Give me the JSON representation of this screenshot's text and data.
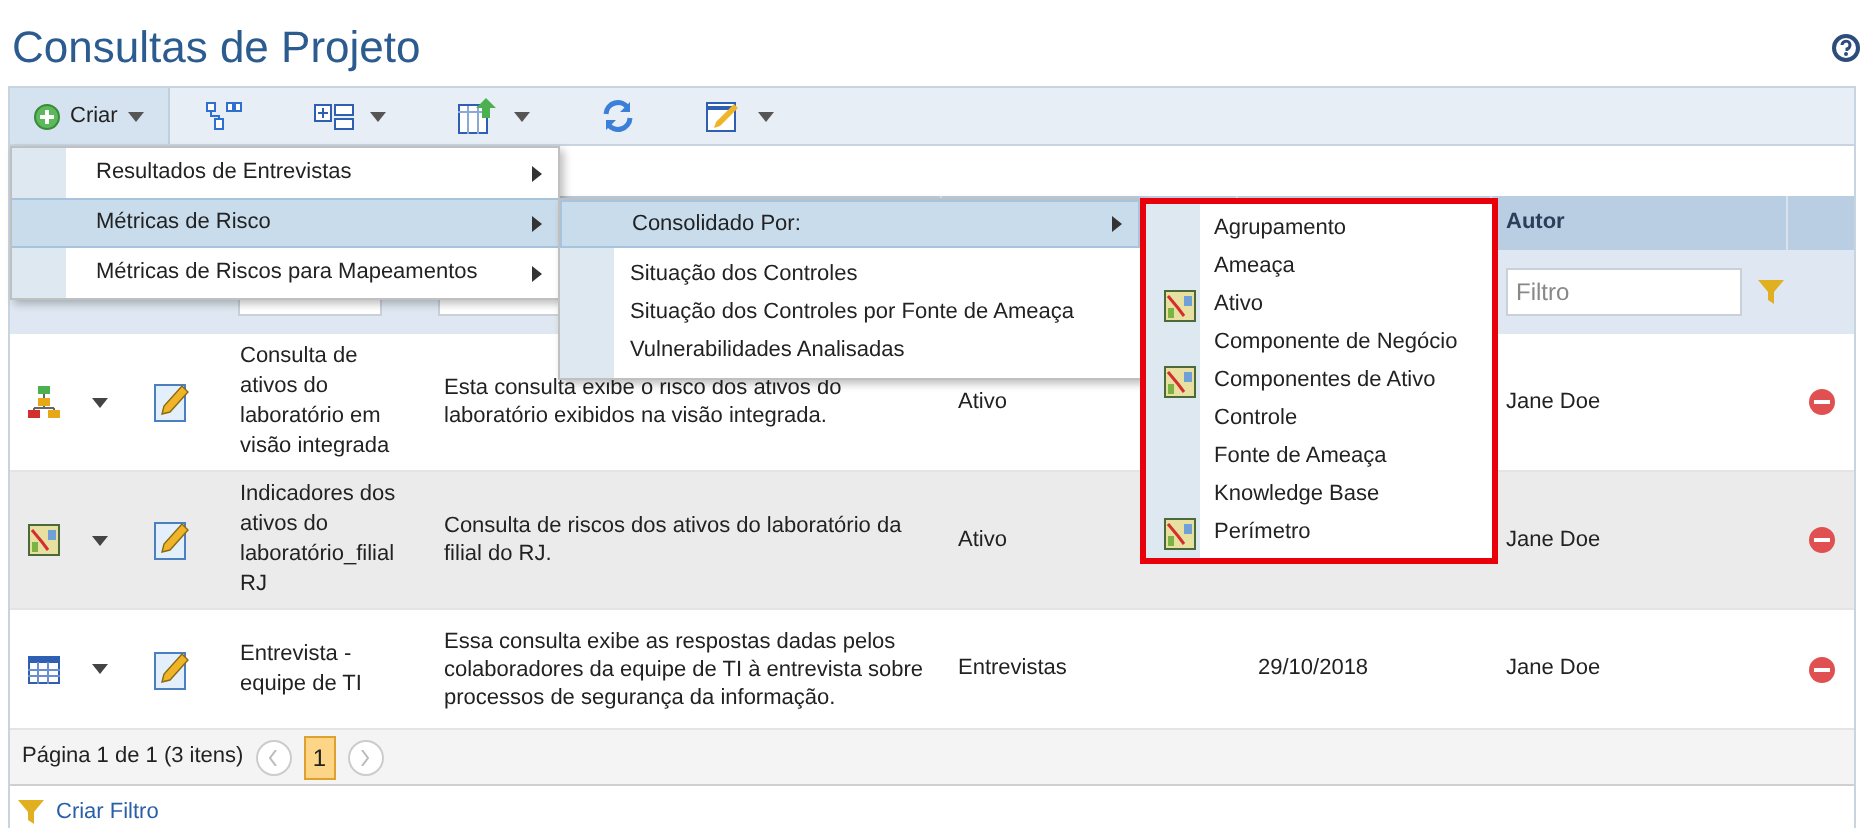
{
  "page": {
    "title": "Consultas de Projeto"
  },
  "toolbar": {
    "create_button": "Criar"
  },
  "create_menu": [
    {
      "label": "Resultados de Entrevistas",
      "selected": false
    },
    {
      "label": "Métricas de Risco",
      "selected": true
    },
    {
      "label": "Métricas de Riscos para Mapeamentos",
      "selected": false
    }
  ],
  "risk_submenu": {
    "header": {
      "label": "Consolidado Por:",
      "selected": true
    },
    "items": [
      "Situação dos Controles",
      "Situação dos Controles por Fonte de Ameaça",
      "Vulnerabilidades Analisadas"
    ]
  },
  "consolidated_submenu": [
    {
      "label": "Agrupamento",
      "has_icon": false
    },
    {
      "label": "Ameaça",
      "has_icon": false
    },
    {
      "label": "Ativo",
      "has_icon": true
    },
    {
      "label": "Componente de Negócio",
      "has_icon": false
    },
    {
      "label": "Componentes de Ativo",
      "has_icon": true
    },
    {
      "label": "Controle",
      "has_icon": false
    },
    {
      "label": "Fonte de Ameaça",
      "has_icon": false
    },
    {
      "label": "Knowledge Base",
      "has_icon": false
    },
    {
      "label": "Perímetro",
      "has_icon": true
    }
  ],
  "table": {
    "author_header": "Autor",
    "filters": [
      {
        "placeholder": "Filtro"
      }
    ],
    "rows": [
      {
        "kind": "hierarchy",
        "selected": false,
        "name": "Consulta de ativos do laboratório em visão integrada",
        "description": "Esta consulta exibe o risco dos ativos do laboratório exibidos na visão integrada.",
        "type": "Ativo",
        "author": "Jane Doe"
      },
      {
        "kind": "chart",
        "selected": true,
        "name": "Indicadores dos ativos do laboratório_filial RJ",
        "description": "Consulta de riscos dos ativos do laboratório da filial do RJ.",
        "type": "Ativo",
        "author": "Jane Doe"
      },
      {
        "kind": "grid",
        "selected": false,
        "name": "Entrevista - equipe de TI",
        "description": "Essa consulta exibe as respostas dadas pelos colaboradores da equipe de TI à entrevista sobre processos de segurança da informação.",
        "type": "Entrevistas",
        "date": "29/10/2018",
        "author": "Jane Doe"
      }
    ]
  },
  "pagination": {
    "summary": "Página 1 de 1 (3 itens)",
    "pages": [
      {
        "label": "1",
        "selected": true
      }
    ]
  },
  "footer": {
    "link": "Criar Filtro"
  }
}
